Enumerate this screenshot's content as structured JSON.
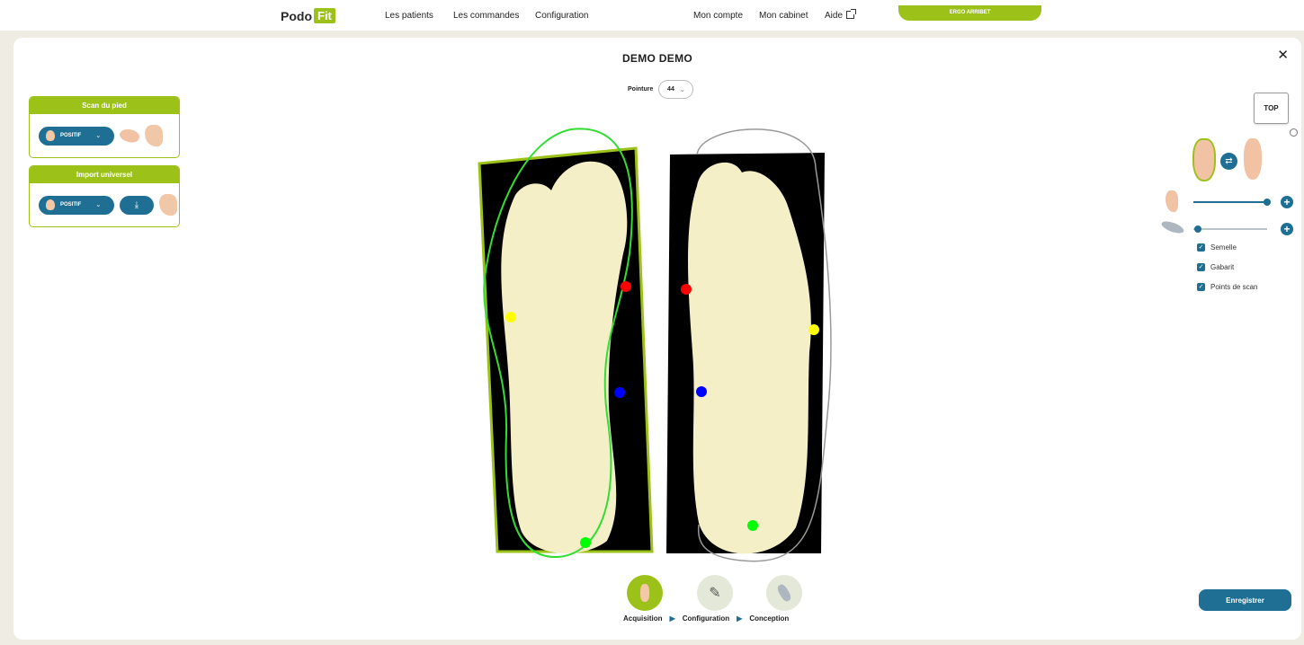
{
  "nav": {
    "logo_left": "Podo",
    "logo_right": "Fit",
    "links": [
      "Les patients",
      "Les commandes",
      "Configuration"
    ],
    "account": "Mon compte",
    "cabinet": "Mon cabinet",
    "help": "Aide",
    "user": "ERGO ARRIBET"
  },
  "patient": {
    "name": "DEMO DEMO",
    "pointure_label": "Pointure",
    "pointure_value": "44"
  },
  "scan_card": {
    "title": "Scan du pied",
    "mode": "POSITIF"
  },
  "import_card": {
    "title": "Import universel",
    "mode": "POSITIF"
  },
  "view": {
    "top_label": "TOP"
  },
  "options": {
    "checkboxes": [
      "Semelle",
      "Gabarit",
      "Points de scan"
    ],
    "slider_foot": 1.0,
    "slider_sole": 0.0
  },
  "workflow": {
    "steps": [
      "Acquisition",
      "Configuration",
      "Conception"
    ],
    "active": "Acquisition"
  },
  "actions": {
    "save": "Enregistrer"
  },
  "colors": {
    "accent": "#9cc21a",
    "primary": "#1e6f93",
    "marker_red": "#ff0000",
    "marker_yellow": "#ffff00",
    "marker_blue": "#0000ff",
    "marker_green": "#00ff00"
  }
}
